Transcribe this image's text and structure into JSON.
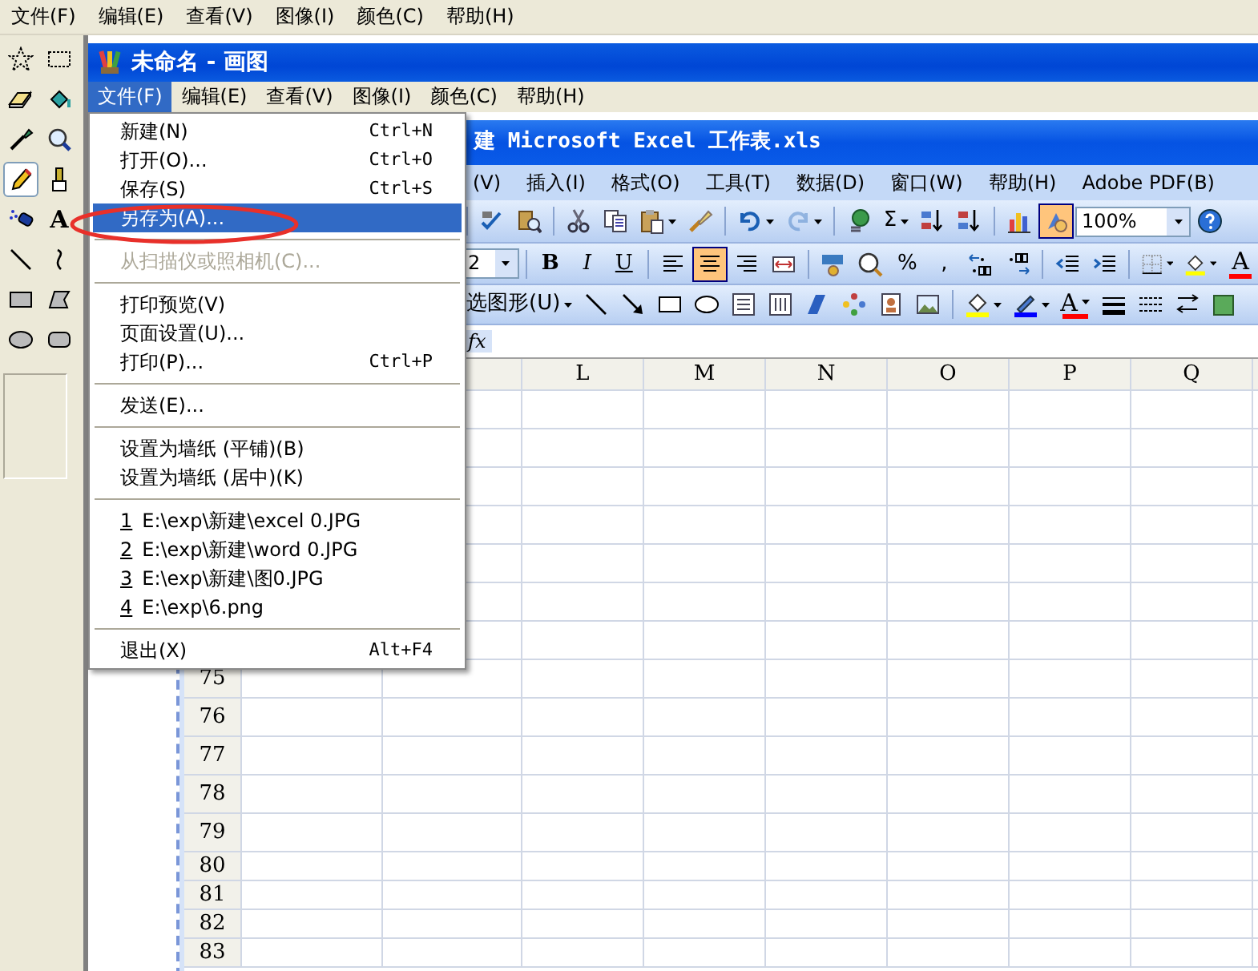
{
  "outer_menu": [
    "文件(F)",
    "编辑(E)",
    "查看(V)",
    "图像(I)",
    "颜色(C)",
    "帮助(H)"
  ],
  "toolbox": {
    "tools": [
      {
        "selected": false
      },
      {
        "selected": false
      },
      {
        "selected": false
      },
      {
        "selected": false
      },
      {
        "selected": false
      },
      {
        "selected": false
      },
      {
        "selected": true
      },
      {
        "selected": false
      },
      {
        "selected": false
      },
      {
        "selected": false,
        "label": "A"
      },
      {
        "selected": false
      },
      {
        "selected": false
      },
      {
        "selected": false
      },
      {
        "selected": false
      },
      {
        "selected": false
      },
      {
        "selected": false
      }
    ]
  },
  "inner_window": {
    "title": "未命名 - 画图",
    "menu": [
      {
        "label": "文件(F)",
        "selected": true
      },
      {
        "label": "编辑(E)",
        "selected": false
      },
      {
        "label": "查看(V)",
        "selected": false
      },
      {
        "label": "图像(I)",
        "selected": false
      },
      {
        "label": "颜色(C)",
        "selected": false
      },
      {
        "label": "帮助(H)",
        "selected": false
      }
    ]
  },
  "file_menu": {
    "items": [
      {
        "kind": "item",
        "label": "新建(N)",
        "shortcut": "Ctrl+N",
        "selected": false,
        "disabled": false
      },
      {
        "kind": "item",
        "label": "打开(O)...",
        "shortcut": "Ctrl+O",
        "selected": false,
        "disabled": false
      },
      {
        "kind": "item",
        "label": "保存(S)",
        "shortcut": "Ctrl+S",
        "selected": false,
        "disabled": false
      },
      {
        "kind": "item",
        "label": "另存为(A)...",
        "selected": true,
        "disabled": false
      },
      {
        "kind": "separator"
      },
      {
        "kind": "item",
        "label": "从扫描仪或照相机(C)...",
        "selected": false,
        "disabled": true
      },
      {
        "kind": "separator"
      },
      {
        "kind": "item",
        "label": "打印预览(V)",
        "selected": false,
        "disabled": false
      },
      {
        "kind": "item",
        "label": "页面设置(U)...",
        "selected": false,
        "disabled": false
      },
      {
        "kind": "item",
        "label": "打印(P)...",
        "shortcut": "Ctrl+P",
        "selected": false,
        "disabled": false
      },
      {
        "kind": "separator"
      },
      {
        "kind": "item",
        "label": "发送(E)...",
        "selected": false,
        "disabled": false
      },
      {
        "kind": "separator"
      },
      {
        "kind": "item",
        "label": "设置为墙纸 (平铺)(B)",
        "selected": false,
        "disabled": false
      },
      {
        "kind": "item",
        "label": "设置为墙纸 (居中)(K)",
        "selected": false,
        "disabled": false
      },
      {
        "kind": "separator"
      },
      {
        "kind": "recent",
        "number": "1",
        "label": "E:\\exp\\新建\\excel 0.JPG",
        "selected": false,
        "disabled": false
      },
      {
        "kind": "recent",
        "number": "2",
        "label": "E:\\exp\\新建\\word 0.JPG",
        "selected": false,
        "disabled": false
      },
      {
        "kind": "recent",
        "number": "3",
        "label": "E:\\exp\\新建\\图0.JPG",
        "selected": false,
        "disabled": false
      },
      {
        "kind": "recent",
        "number": "4",
        "label": "E:\\exp\\6.png",
        "selected": false,
        "disabled": false
      },
      {
        "kind": "separator"
      },
      {
        "kind": "item",
        "label": "退出(X)",
        "shortcut": "Alt+F4",
        "selected": false,
        "disabled": false
      }
    ]
  },
  "excel": {
    "title": "建 Microsoft Excel 工作表.xls",
    "menu": [
      "(V)",
      "插入(I)",
      "格式(O)",
      "工具(T)",
      "数据(D)",
      "窗口(W)",
      "帮助(H)",
      "Adobe PDF(B)"
    ],
    "toolbars": [
      {
        "items": [
          {
            "kind": "icon",
            "pressed": false,
            "disabled": false
          },
          {
            "kind": "icon",
            "pressed": false,
            "disabled": false
          },
          {
            "kind": "icon",
            "pressed": false,
            "disabled": false
          },
          {
            "kind": "icon",
            "pressed": false,
            "disabled": false
          },
          {
            "kind": "icon",
            "pressed": false,
            "disabled": false
          },
          {
            "kind": "icon",
            "pressed": false,
            "disabled": false
          },
          {
            "kind": "icon",
            "pressed": false,
            "disabled": false
          },
          {
            "kind": "icon",
            "pressed": false,
            "disabled": true
          },
          {
            "kind": "icon",
            "pressed": false,
            "disabled": false
          },
          {
            "kind": "text",
            "label": "Σ",
            "pressed": false,
            "disabled": false
          },
          {
            "kind": "icon",
            "pressed": false,
            "disabled": false
          },
          {
            "kind": "icon",
            "pressed": false,
            "disabled": false
          },
          {
            "kind": "icon",
            "pressed": false,
            "disabled": false
          },
          {
            "kind": "icon",
            "pressed": true,
            "disabled": false
          },
          {
            "kind": "field",
            "value": "100%"
          },
          {
            "kind": "icon",
            "pressed": false,
            "disabled": false
          }
        ]
      },
      {
        "items": [
          {
            "kind": "field",
            "value": "2"
          },
          {
            "kind": "text",
            "label": "B",
            "pressed": false,
            "disabled": false
          },
          {
            "kind": "text",
            "label": "I",
            "pressed": false,
            "disabled": false
          },
          {
            "kind": "text",
            "label": "U",
            "pressed": false,
            "disabled": false
          },
          {
            "kind": "icon",
            "pressed": false,
            "disabled": false
          },
          {
            "kind": "icon",
            "pressed": true,
            "disabled": false
          },
          {
            "kind": "icon",
            "pressed": false,
            "disabled": false
          },
          {
            "kind": "icon",
            "pressed": false,
            "disabled": false
          },
          {
            "kind": "icon",
            "pressed": false,
            "disabled": false
          },
          {
            "kind": "icon",
            "pressed": false,
            "disabled": false
          },
          {
            "kind": "text",
            "label": "%",
            "pressed": false,
            "disabled": false
          },
          {
            "kind": "text",
            "label": ",",
            "pressed": false,
            "disabled": false
          },
          {
            "kind": "icon",
            "pressed": false,
            "disabled": false
          },
          {
            "kind": "icon",
            "pressed": false,
            "disabled": false
          },
          {
            "kind": "icon",
            "pressed": false,
            "disabled": false
          },
          {
            "kind": "icon",
            "pressed": false,
            "disabled": false
          },
          {
            "kind": "icon",
            "pressed": false,
            "disabled": false
          },
          {
            "kind": "icon",
            "pressed": false,
            "disabled": false
          },
          {
            "kind": "text",
            "label": "A",
            "pressed": false,
            "disabled": false
          }
        ]
      },
      {
        "items": [
          {
            "kind": "text",
            "label": "选图形(U)",
            "pressed": false,
            "disabled": false
          },
          {
            "kind": "icon",
            "pressed": false,
            "disabled": false
          },
          {
            "kind": "icon",
            "pressed": false,
            "disabled": false
          },
          {
            "kind": "icon",
            "pressed": false,
            "disabled": false
          },
          {
            "kind": "icon",
            "pressed": false,
            "disabled": false
          },
          {
            "kind": "icon",
            "pressed": false,
            "disabled": false
          },
          {
            "kind": "icon",
            "pressed": false,
            "disabled": false
          },
          {
            "kind": "icon",
            "pressed": false,
            "disabled": false
          },
          {
            "kind": "icon",
            "pressed": false,
            "disabled": false
          },
          {
            "kind": "icon",
            "pressed": false,
            "disabled": false
          },
          {
            "kind": "icon",
            "pressed": false,
            "disabled": false
          },
          {
            "kind": "icon",
            "pressed": false,
            "disabled": false
          },
          {
            "kind": "icon",
            "pressed": false,
            "disabled": false
          },
          {
            "kind": "text",
            "label": "A",
            "pressed": false,
            "disabled": false
          },
          {
            "kind": "icon",
            "pressed": false,
            "disabled": false
          },
          {
            "kind": "icon",
            "pressed": false,
            "disabled": false
          },
          {
            "kind": "icon",
            "pressed": false,
            "disabled": false
          },
          {
            "kind": "icon",
            "pressed": false,
            "disabled": false
          }
        ]
      }
    ],
    "formula_bar": {
      "label": "fx"
    },
    "columns": [
      "L",
      "M",
      "N",
      "O",
      "P",
      "Q"
    ],
    "rows": [
      "75",
      "76",
      "77",
      "78",
      "79",
      "80",
      "81",
      "82",
      "83"
    ]
  }
}
